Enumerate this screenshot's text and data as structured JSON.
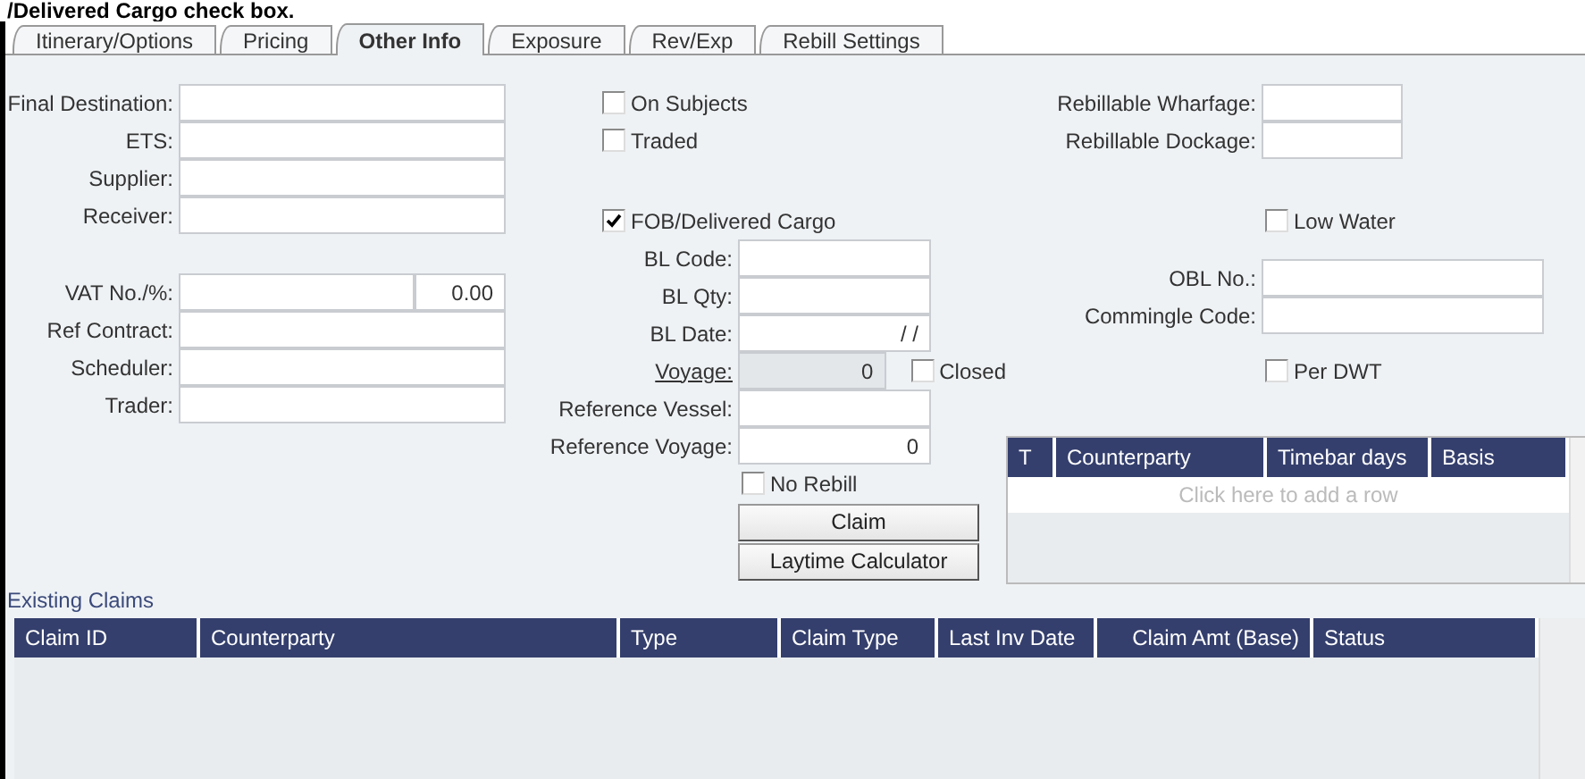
{
  "caption": "/Delivered Cargo check box.",
  "tabs": [
    {
      "label": "Itinerary/Options",
      "selected": false
    },
    {
      "label": "Pricing",
      "selected": false
    },
    {
      "label": "Other Info",
      "selected": true
    },
    {
      "label": "Exposure",
      "selected": false
    },
    {
      "label": "Rev/Exp",
      "selected": false
    },
    {
      "label": "Rebill Settings",
      "selected": false
    }
  ],
  "left_groups": [
    [
      {
        "kind": "field",
        "label": "Final Destination:"
      },
      {
        "kind": "field",
        "label": "ETS:"
      },
      {
        "kind": "field",
        "label": "Supplier:"
      },
      {
        "kind": "field",
        "label": "Receiver:"
      }
    ],
    [
      {
        "kind": "split",
        "label": "VAT No./%:",
        "percent": "0.00"
      },
      {
        "kind": "field",
        "label": "Ref Contract:"
      },
      {
        "kind": "field",
        "label": "Scheduler:"
      },
      {
        "kind": "field",
        "label": "Trader:"
      }
    ]
  ],
  "middle_groups": [
    [
      {
        "kind": "check",
        "label": "On Subjects",
        "checked": false
      },
      {
        "kind": "check",
        "label": "Traded",
        "checked": false
      }
    ],
    [
      {
        "kind": "check",
        "label": "FOB/Delivered Cargo",
        "checked": true
      },
      {
        "kind": "field",
        "label": "BL Code:"
      },
      {
        "kind": "field",
        "label": "BL Qty:"
      },
      {
        "kind": "field",
        "label": "BL Date:",
        "value": "/ /"
      },
      {
        "kind": "link_field",
        "label": "Voyage:",
        "value": "0",
        "disabled": true,
        "side_check": {
          "label": "Closed",
          "checked": false
        }
      },
      {
        "kind": "field",
        "label": "Reference Vessel:"
      },
      {
        "kind": "field",
        "label": "Reference Voyage:",
        "value": "0"
      },
      {
        "kind": "check_field",
        "label": "No Rebill",
        "checked": false
      },
      {
        "kind": "button",
        "label": "Claim"
      },
      {
        "kind": "button",
        "label": "Laytime Calculator"
      }
    ]
  ],
  "right_groups": [
    [
      {
        "kind": "field",
        "label": "Rebillable Wharfage:"
      },
      {
        "kind": "field",
        "label": "Rebillable Dockage:"
      }
    ],
    [
      {
        "kind": "check_field",
        "label": "Low Water",
        "checked": false
      }
    ],
    [
      {
        "kind": "field",
        "label": "OBL No.:"
      },
      {
        "kind": "field",
        "label": "Commingle Code:"
      }
    ],
    [
      {
        "kind": "check_field",
        "label": "Per DWT",
        "checked": false
      }
    ]
  ],
  "rebill_grid": {
    "columns": [
      "T",
      "Counterparty",
      "Timebar days",
      "Basis"
    ],
    "placeholder_row": "Click here to add a row"
  },
  "claims": {
    "title": "Existing Claims",
    "columns": [
      "Claim ID",
      "Counterparty",
      "Type",
      "Claim Type",
      "Last Inv Date",
      "Claim Amt (Base)",
      "Status"
    ]
  }
}
